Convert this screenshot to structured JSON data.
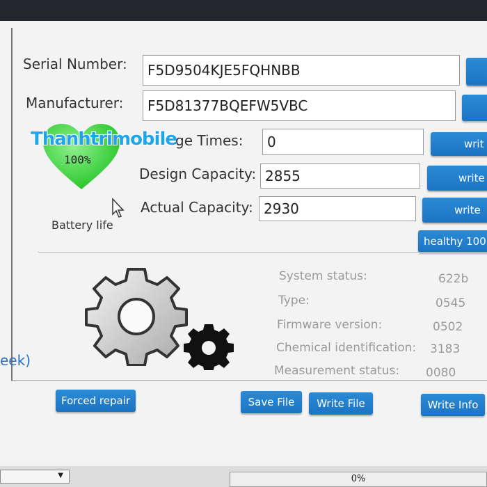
{
  "fields": {
    "serial_label": "Serial Number:",
    "serial_value": "F5D9504KJE5FQHNBB",
    "manufacturer_label": "Manufacturer:",
    "manufacturer_value": "F5D81377BQEFW5VBC",
    "cycle_label": "ge Times:",
    "cycle_value": "0",
    "design_label": "Design Capacity:",
    "design_value": "2855",
    "actual_label": "Actual Capacity:",
    "actual_value": "2930"
  },
  "buttons": {
    "write_partial": "writ",
    "write": "write",
    "healthy": "healthy 100",
    "forced_repair": "Forced repair",
    "save_file": "Save File",
    "write_file": "Write File",
    "write_info": "Write Info"
  },
  "battery": {
    "percent": "100%",
    "label": "Battery life",
    "watermark": "Thanhtrimobile"
  },
  "status": {
    "system_status_label": "System status:",
    "system_status_value": "622b",
    "type_label": "Type:",
    "type_value": "0545",
    "firmware_label": "Firmware version:",
    "firmware_value": "0502",
    "chem_label": "Chemical identification:",
    "chem_value": "3183",
    "measurement_label": "Measurement status:",
    "measurement_value": "0080"
  },
  "side_text": "eek)",
  "progress": {
    "text": "0%",
    "fraction": 0
  },
  "colors": {
    "accent": "#1c74c4",
    "heart": "#3fd43f",
    "watermark": "#1ea6e8"
  }
}
